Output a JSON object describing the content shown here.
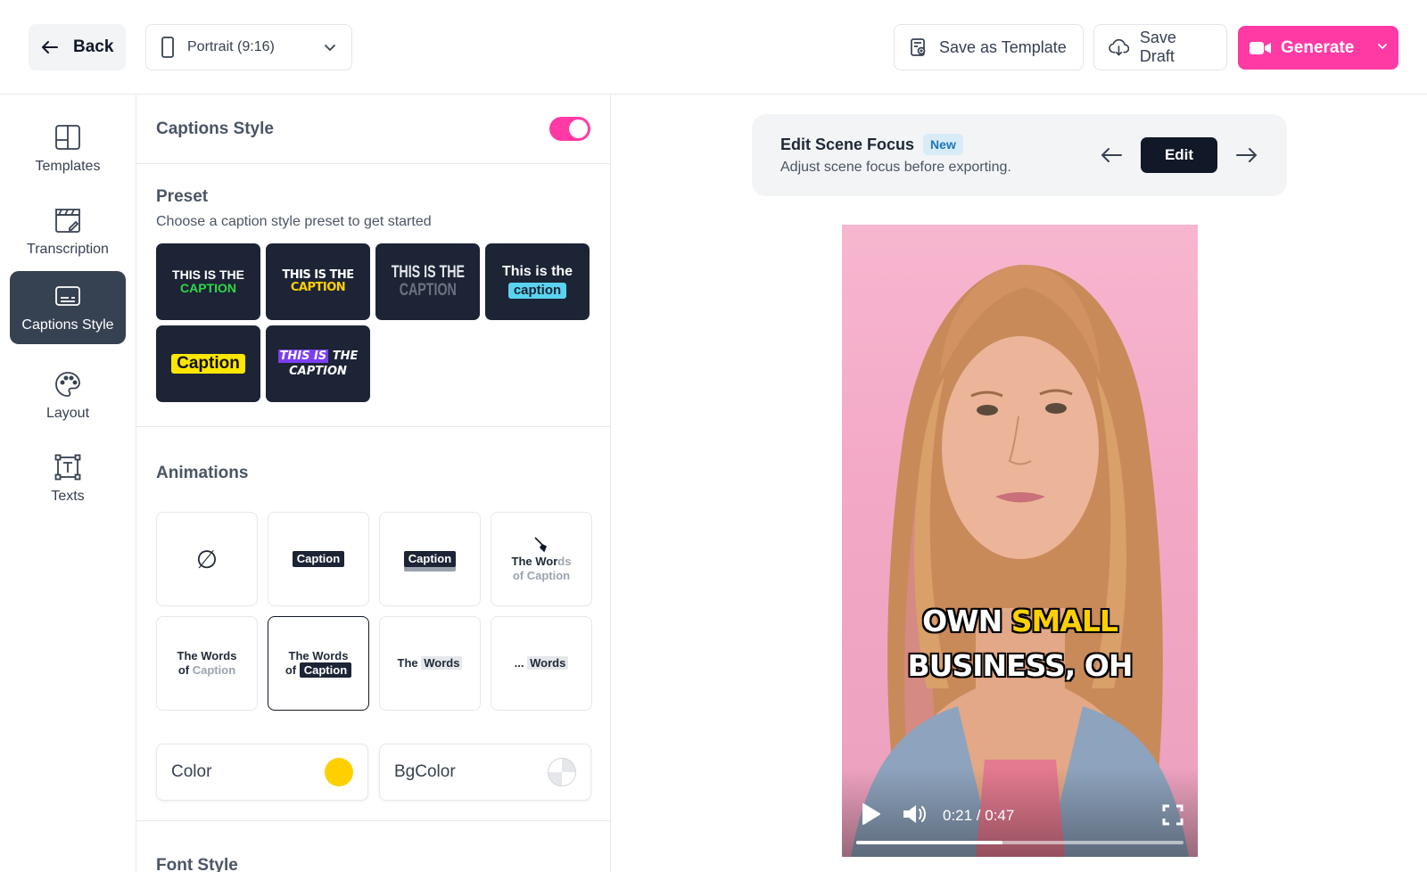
{
  "topbar": {
    "back_label": "Back",
    "aspect_label": "Portrait (9:16)",
    "save_template_label": "Save as Template",
    "save_draft_label": "Save Draft",
    "generate_label": "Generate"
  },
  "sidebar": {
    "items": [
      {
        "label": "Templates",
        "icon": "templates-icon"
      },
      {
        "label": "Transcription",
        "icon": "clapperboard-icon"
      },
      {
        "label": "Captions Style",
        "icon": "captions-icon",
        "active": true
      },
      {
        "label": "Layout",
        "icon": "palette-icon"
      },
      {
        "label": "Texts",
        "icon": "text-box-icon"
      }
    ]
  },
  "panel": {
    "title": "Captions Style",
    "toggle_on": true,
    "preset_title": "Preset",
    "preset_subtitle": "Choose a caption style preset to get started",
    "presets": [
      {
        "line1": "THIS IS THE",
        "line2": "CAPTION"
      },
      {
        "line1": "THIS IS THE",
        "line2": "CAPTION"
      },
      {
        "line1": "THIS IS THE",
        "line2": "CAPTION"
      },
      {
        "line1": "This is the",
        "line2": "caption"
      },
      {
        "line1": "Caption",
        "line2": ""
      },
      {
        "line1": "THIS IS",
        "line1b": "THE",
        "line2": "CAPTION"
      }
    ],
    "animations_title": "Animations",
    "animations": [
      {
        "label": "∅"
      },
      {
        "label": "Caption"
      },
      {
        "label": "Caption"
      },
      {
        "line1a": "The Wor",
        "line1b": "ds",
        "line2": "of Caption"
      },
      {
        "line1": "The Words",
        "line2a": "of ",
        "line2b": "Caption"
      },
      {
        "line1": "The Words",
        "line2a": "of ",
        "line2b": "Caption"
      },
      {
        "a": "The ",
        "b": "Words"
      },
      {
        "a": "... ",
        "b": "Words"
      }
    ],
    "color_label": "Color",
    "bgcolor_label": "BgColor",
    "color_value": "#ffd000",
    "font_style_title": "Font Style"
  },
  "scene": {
    "title": "Edit Scene Focus",
    "badge": "New",
    "subtitle": "Adjust scene focus before exporting.",
    "edit_label": "Edit"
  },
  "video": {
    "caption_word1": "OWN",
    "caption_word2": "SMALL",
    "caption_line2": "BUSINESS, OH",
    "time": "0:21 / 0:47",
    "progress": 0.447
  },
  "colors": {
    "accent": "#ff3aa4",
    "dark": "#1c2435",
    "caption_highlight": "#ffd000"
  }
}
